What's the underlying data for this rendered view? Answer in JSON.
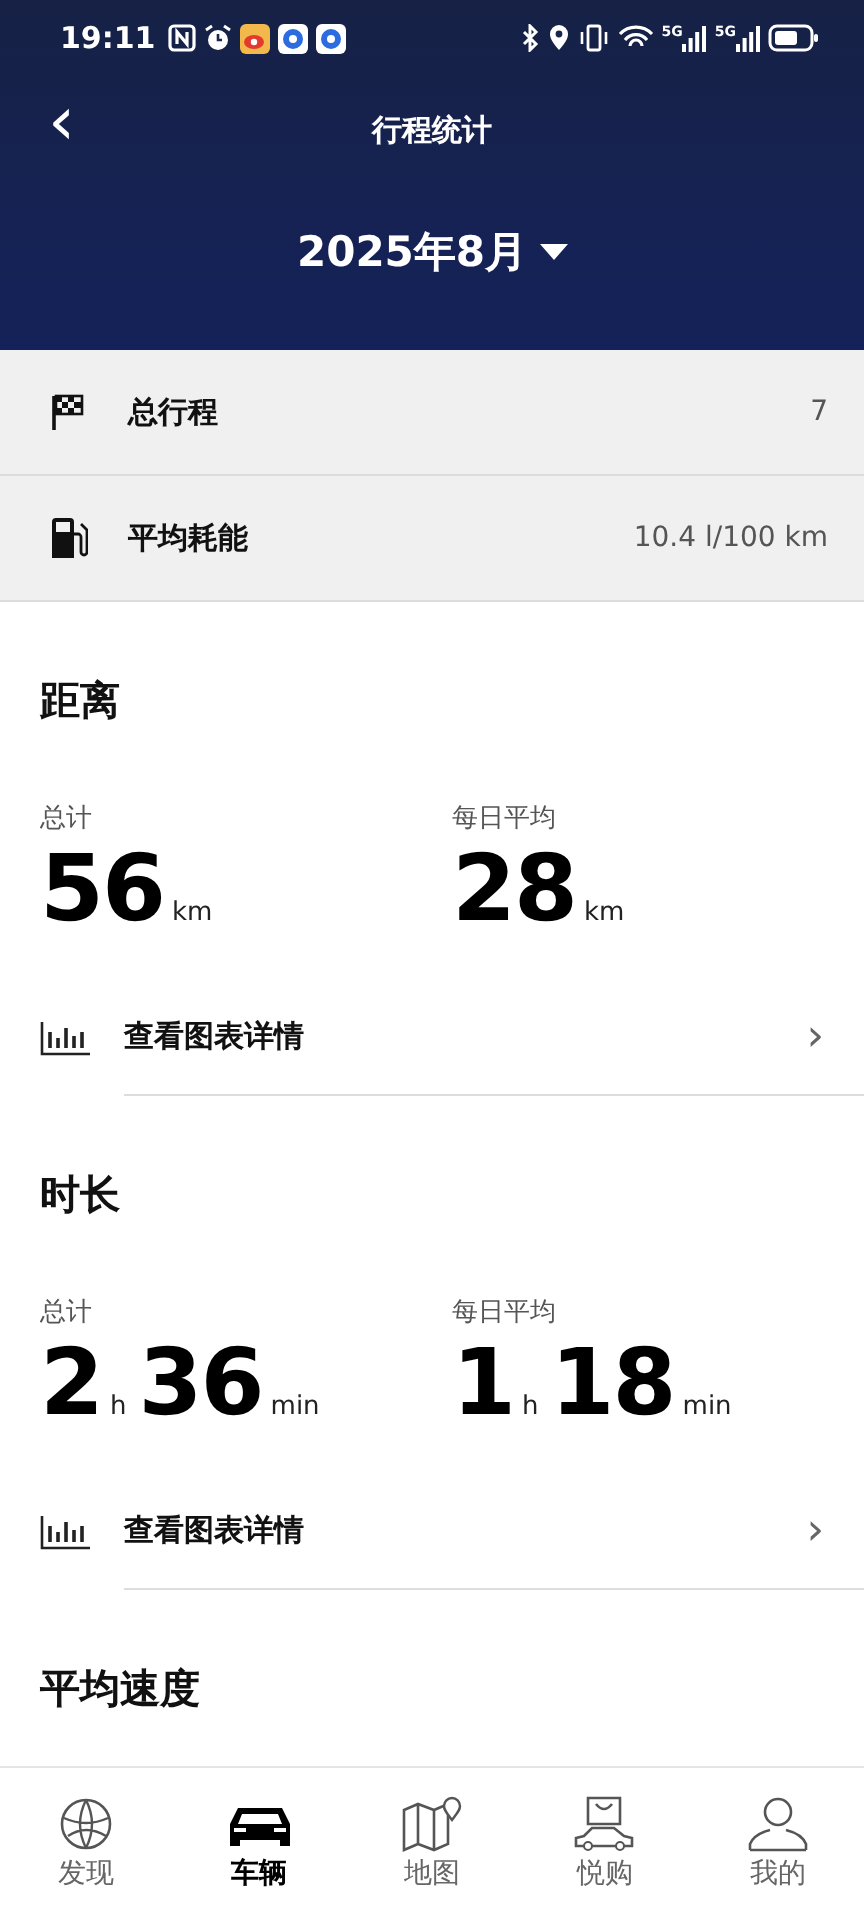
{
  "status_bar": {
    "time": "19:11",
    "signals": [
      {
        "network": "5G"
      },
      {
        "network": "5G"
      }
    ]
  },
  "header": {
    "title": "行程统计",
    "back": "‹",
    "month": "2025年8月"
  },
  "summary": [
    {
      "kind": "trips",
      "label": "总行程",
      "value": "7"
    },
    {
      "kind": "fuel",
      "label": "平均耗能",
      "value": "10.4 l/100 km"
    }
  ],
  "sections": [
    {
      "title": "距离",
      "stats": [
        {
          "label": "总计",
          "parts": [
            {
              "num": "56",
              "unit": "km"
            }
          ]
        },
        {
          "label": "每日平均",
          "parts": [
            {
              "num": "28",
              "unit": "km"
            }
          ]
        }
      ],
      "link": "查看图表详情",
      "chevron": "›"
    },
    {
      "title": "时长",
      "stats": [
        {
          "label": "总计",
          "parts": [
            {
              "num": "2",
              "unit": "h"
            },
            {
              "num": "36",
              "unit": "min"
            }
          ]
        },
        {
          "label": "每日平均",
          "parts": [
            {
              "num": "1",
              "unit": "h"
            },
            {
              "num": "18",
              "unit": "min"
            }
          ]
        }
      ],
      "link": "查看图表详情",
      "chevron": "›"
    },
    {
      "title": "平均速度"
    }
  ],
  "nav": [
    {
      "label": "发现",
      "selected": false
    },
    {
      "label": "车辆",
      "selected": true
    },
    {
      "label": "地图",
      "selected": false
    },
    {
      "label": "悦购",
      "selected": false
    },
    {
      "label": "我的",
      "selected": false
    }
  ]
}
